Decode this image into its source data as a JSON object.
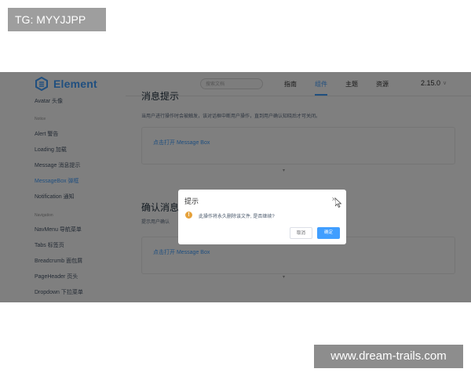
{
  "tag_label": "TG: MYYJJPP",
  "watermark": "www.dream-trails.com",
  "header": {
    "logo_text": "Element",
    "search_placeholder": "搜索文档",
    "nav": [
      "指南",
      "组件",
      "主题",
      "资源"
    ],
    "active_nav": "组件",
    "version": "2.15.0"
  },
  "sidebar": {
    "items": [
      {
        "label": "Avatar 头像"
      },
      {
        "group": "Notice"
      },
      {
        "label": "Alert 警告"
      },
      {
        "label": "Loading 加载"
      },
      {
        "label": "Message 消息提示"
      },
      {
        "label": "MessageBox 弹框",
        "active": true
      },
      {
        "label": "Notification 通知"
      },
      {
        "group": "Navigation"
      },
      {
        "label": "NavMenu 导航菜单"
      },
      {
        "label": "Tabs 标签页"
      },
      {
        "label": "Breadcrumb 面包屑"
      },
      {
        "label": "PageHeader 页头"
      },
      {
        "label": "Dropdown 下拉菜单"
      }
    ]
  },
  "content": {
    "section1_title": "消息提示",
    "section1_desc": "当用户进行操作时会被触发，该对话框中断用户操作，直到用户确认知晓后才可关闭。",
    "section1_link": "点击打开 Message Box",
    "section2_title": "确认消息",
    "section2_desc": "提示用户确认",
    "section2_link": "点击打开 Message Box"
  },
  "dialog": {
    "title": "提示",
    "close_icon": "close-icon",
    "message": "此操作将永久删除该文件, 是否继续?",
    "cancel_label": "取消",
    "confirm_label": "确定",
    "warning_icon": "warning-icon"
  },
  "colors": {
    "accent": "#409eff",
    "warning": "#e6a23c",
    "overlay": "rgba(0,0,0,0.5)"
  }
}
